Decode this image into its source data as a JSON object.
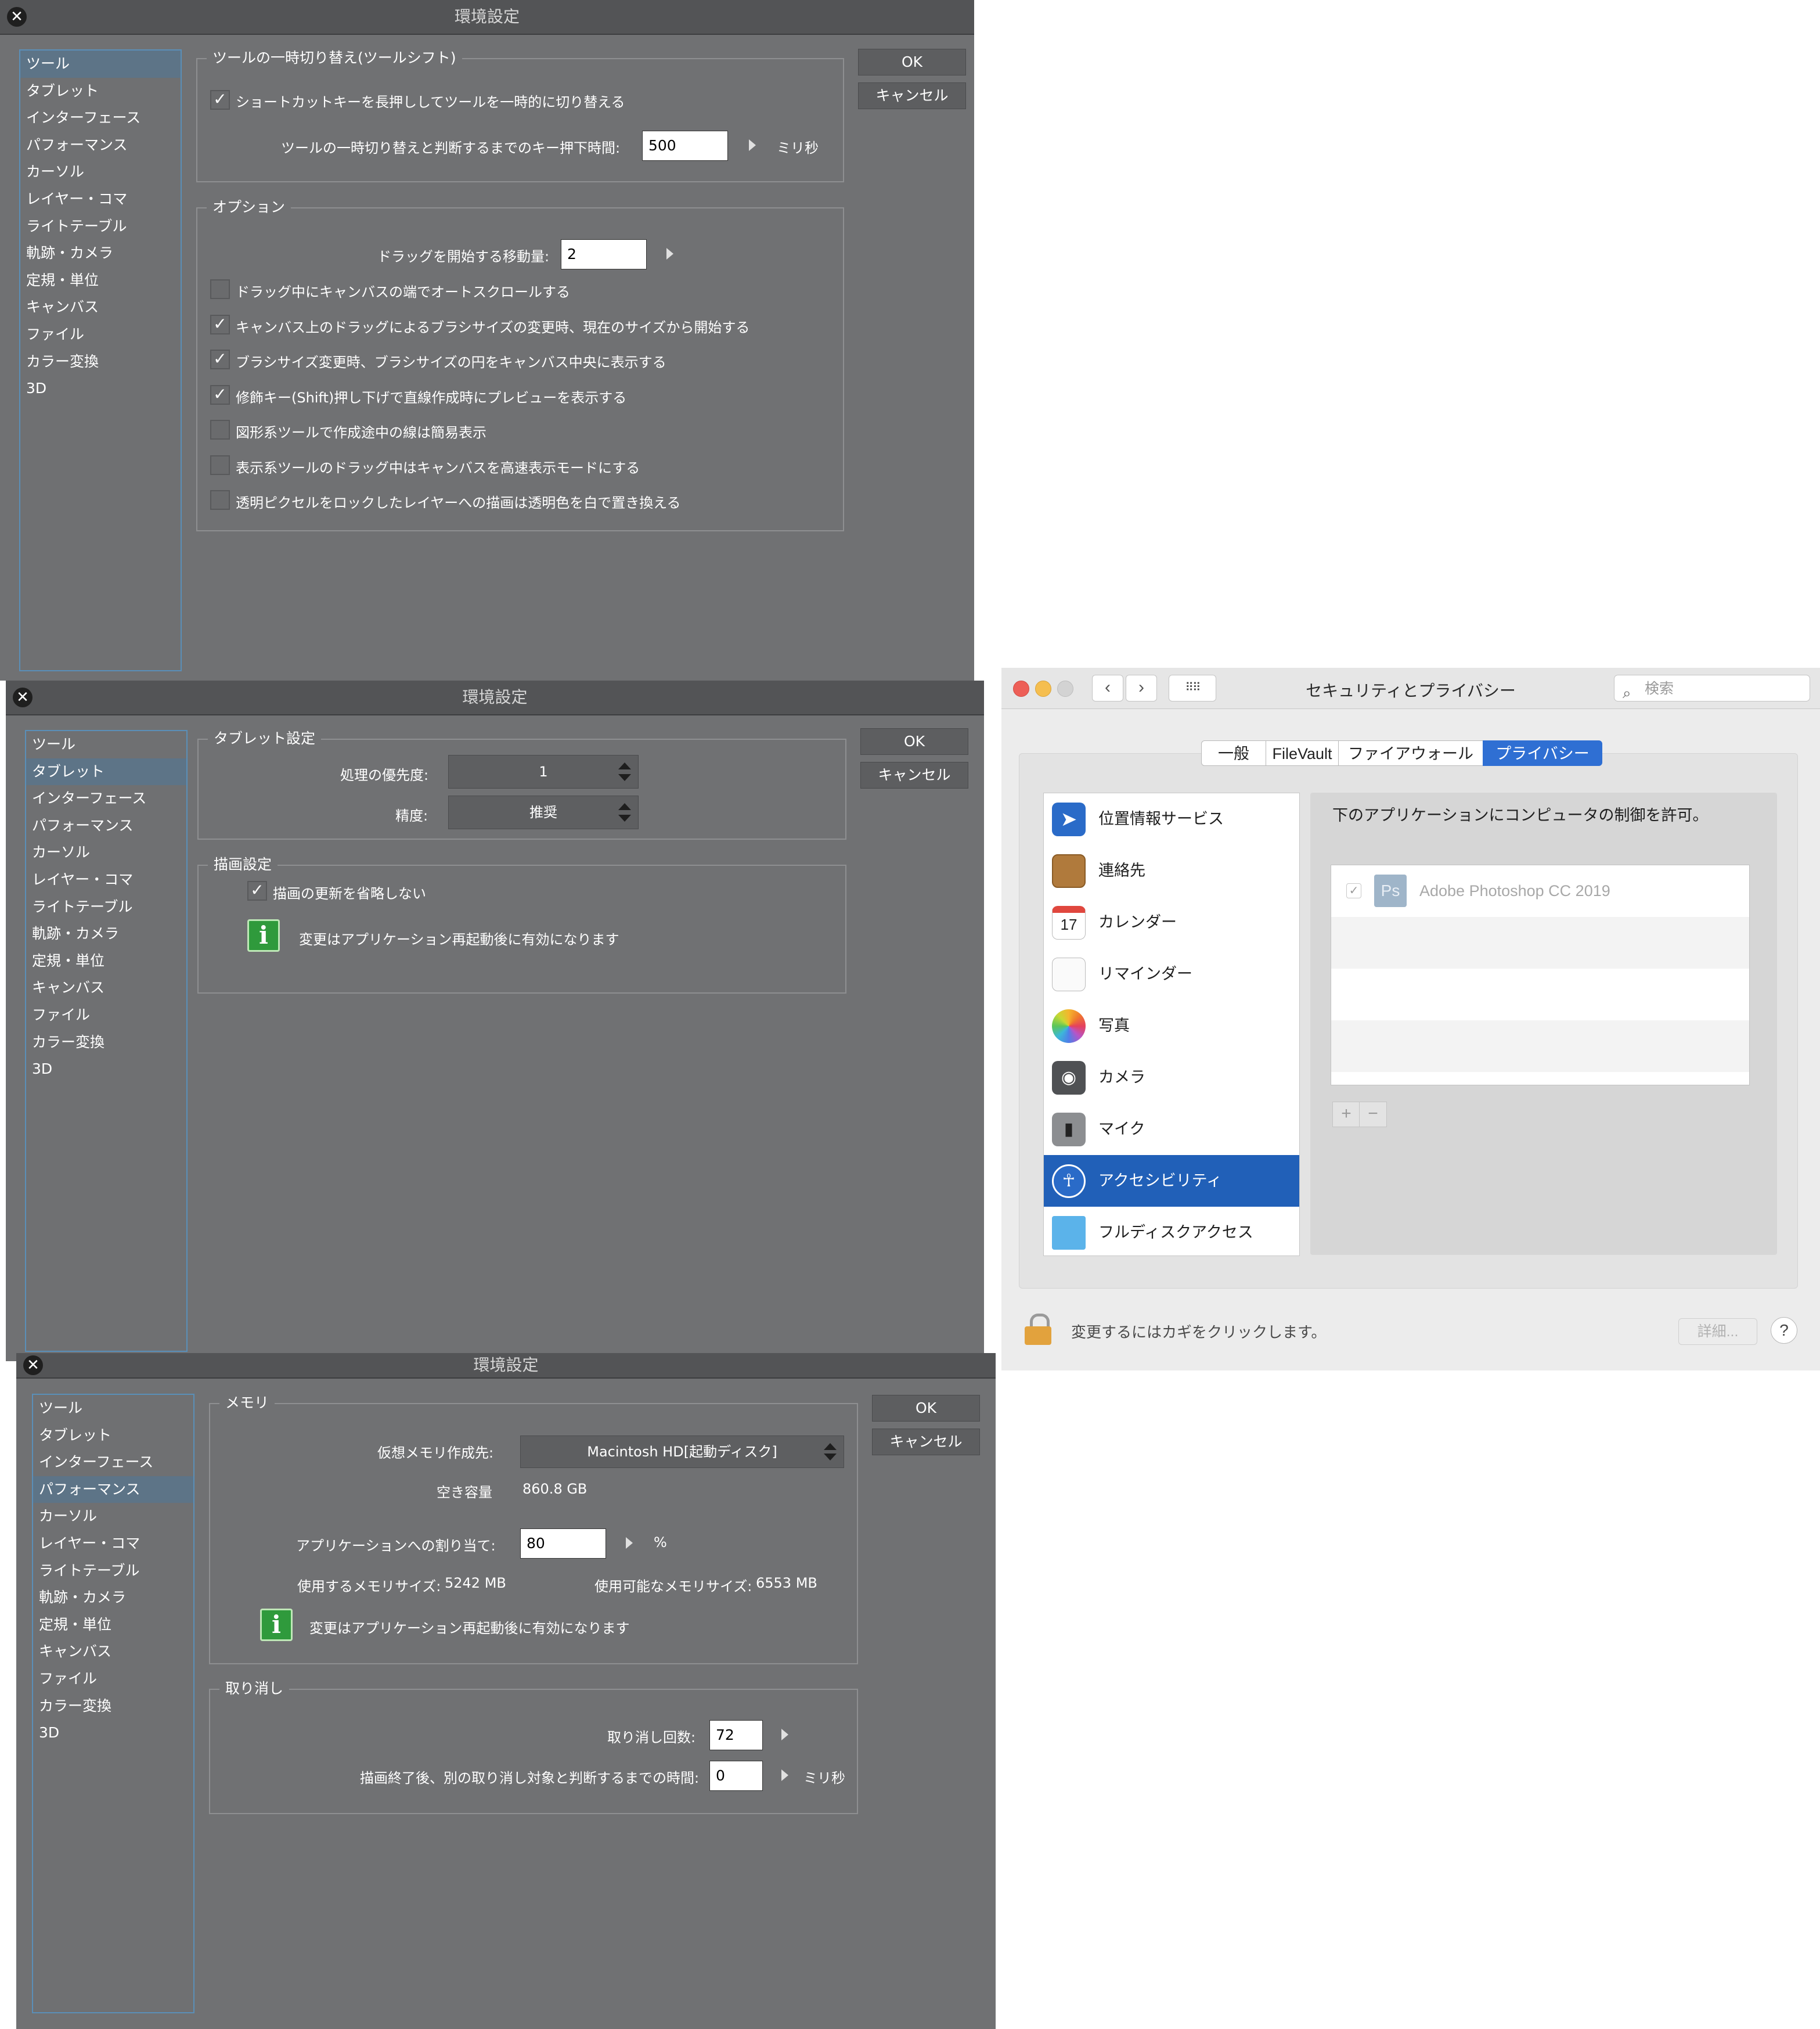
{
  "dialog_title": "環境設定",
  "nav_items": [
    "ツール",
    "タブレット",
    "インターフェース",
    "パフォーマンス",
    "カーソル",
    "レイヤー・コマ",
    "ライトテーブル",
    "軌跡・カメラ",
    "定規・単位",
    "キャンバス",
    "ファイル",
    "カラー変換",
    "3D"
  ],
  "ok_label": "OK",
  "cancel_label": "キャンセル",
  "tool": {
    "group1_label": "ツールの一時切り替え(ツールシフト)",
    "shortcut_check": "ショートカットキーを長押ししてツールを一時的に切り替える",
    "keypress_label": "ツールの一時切り替えと判断するまでのキー押下時間:",
    "keypress_value": "500",
    "keypress_unit": "ミリ秒",
    "group2_label": "オプション",
    "drag_label": "ドラッグを開始する移動量:",
    "drag_value": "2",
    "options": [
      {
        "label": "ドラッグ中にキャンバスの端でオートスクロールする",
        "checked": false
      },
      {
        "label": "キャンバス上のドラッグによるブラシサイズの変更時、現在のサイズから開始する",
        "checked": true
      },
      {
        "label": "ブラシサイズ変更時、ブラシサイズの円をキャンバス中央に表示する",
        "checked": true
      },
      {
        "label": "修飾キー(Shift)押し下げで直線作成時にプレビューを表示する",
        "checked": true
      },
      {
        "label": "図形系ツールで作成途中の線は簡易表示",
        "checked": false
      },
      {
        "label": "表示系ツールのドラッグ中はキャンバスを高速表示モードにする",
        "checked": false
      },
      {
        "label": "透明ピクセルをロックしたレイヤーへの描画は透明色を白で置き換える",
        "checked": false
      }
    ],
    "check_mark": "✓"
  },
  "tablet": {
    "group1_label": "タブレット設定",
    "priority_label": "処理の優先度:",
    "priority_value": "1",
    "precision_label": "精度:",
    "precision_value": "推奨",
    "group2_label": "描画設定",
    "draw_check": "描画の更新を省略しない",
    "restart_note": "変更はアプリケーション再起動後に有効になります",
    "info_glyph": "i"
  },
  "perf": {
    "group1_label": "メモリ",
    "vmem_label": "仮想メモリ作成先:",
    "vmem_value": "Macintosh HD[起動ディスク]",
    "free_label": "空き容量",
    "free_value": "860.8 GB",
    "alloc_label": "アプリケーションへの割り当て:",
    "alloc_value": "80",
    "alloc_unit": "%",
    "used_label": "使用するメモリサイズ:",
    "used_value": "5242 MB",
    "avail_label": "使用可能なメモリサイズ:",
    "avail_value": "6553 MB",
    "restart_note": "変更はアプリケーション再起動後に有効になります",
    "group2_label": "取り消し",
    "undo_label": "取り消し回数:",
    "undo_value": "72",
    "undo_time_label": "描画終了後、別の取り消し対象と判断するまでの時間:",
    "undo_time_value": "0",
    "undo_time_unit": "ミリ秒"
  },
  "mac": {
    "title": "セキュリティとプライバシー",
    "search_placeholder": "検索",
    "back": "‹",
    "forward": "›",
    "grid_icon": "⠿⠿",
    "tabs": [
      "一般",
      "FileVault",
      "ファイアウォール",
      "プライバシー"
    ],
    "privacy_items": [
      "位置情報サービス",
      "連絡先",
      "カレンダー",
      "リマインダー",
      "写真",
      "カメラ",
      "マイク",
      "アクセシビリティ",
      "フルディスクアクセス"
    ],
    "selected_item": "アクセシビリティ",
    "right_desc": "下のアプリケーションにコンピュータの制御を許可。",
    "app_name": "Adobe Photoshop CC 2019",
    "app_icon_text": "Ps",
    "plus": "+",
    "minus": "−",
    "lock_text": "変更するにはカギをクリックします。",
    "detail_label": "詳細...",
    "help_label": "?",
    "calendar_day": "17",
    "colors": {
      "selected_blue": "#2160b8",
      "tab_blue": "#2f6fd3",
      "close": "#ed5f57",
      "minimize": "#f5be4f"
    }
  }
}
